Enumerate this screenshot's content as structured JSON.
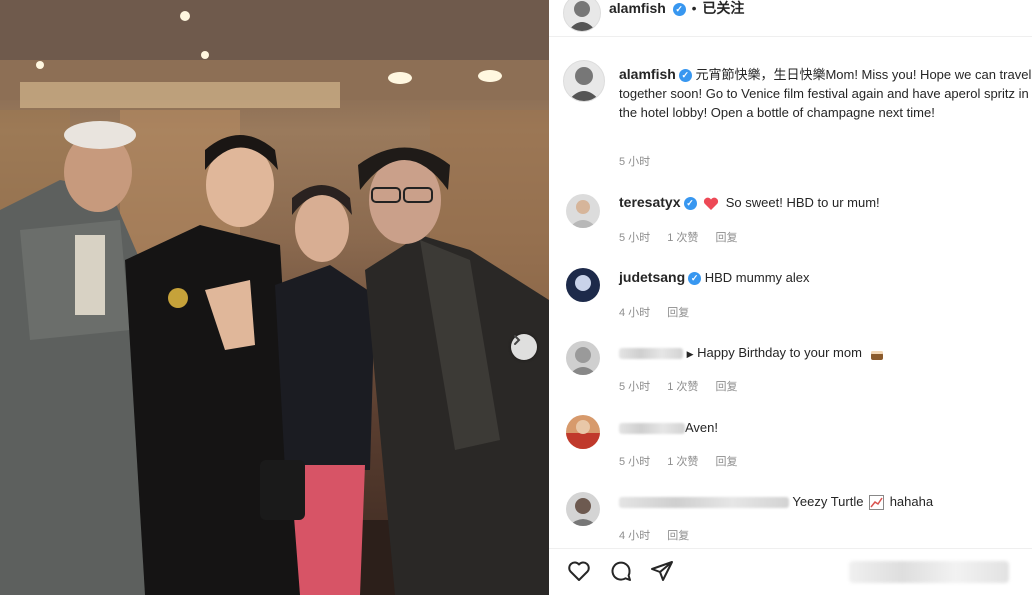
{
  "header": {
    "username": "alamfish",
    "follow_status": "已关注"
  },
  "post": {
    "username": "alamfish",
    "caption": "元宵節快樂，生日快樂Mom! Miss you! Hope we can travel together soon! Go to Venice film festival again and have aperol spritz in the hotel lobby! Open a bottle of champagne next time!",
    "time": "5 小时"
  },
  "comments": [
    {
      "username": "teresatyx",
      "verified": true,
      "text": "So sweet! HBD to ur mum!",
      "time": "5 小时",
      "likes": "1 次赞",
      "reply": "回复"
    },
    {
      "username": "judetsang",
      "verified": true,
      "text": "HBD mummy alex",
      "time": "4 小时",
      "reply": "回复"
    },
    {
      "text": "Happy Birthday to your mom",
      "time": "5 小时",
      "likes": "1 次赞",
      "reply": "回复"
    },
    {
      "text": "Aven!",
      "time": "5 小时",
      "likes": "1 次赞",
      "reply": "回复"
    },
    {
      "text": "Yeezy Turtle",
      "suffix": "hahaha",
      "time": "4 小时",
      "reply": "回复"
    }
  ],
  "colors": {
    "verified_blue": "#3897f0",
    "heart_red": "#ed4956",
    "meta_gray": "#8e8e8e"
  },
  "icons": [
    "heart-icon",
    "comment-icon",
    "share-icon",
    "next-arrow-icon",
    "verified-icon"
  ]
}
